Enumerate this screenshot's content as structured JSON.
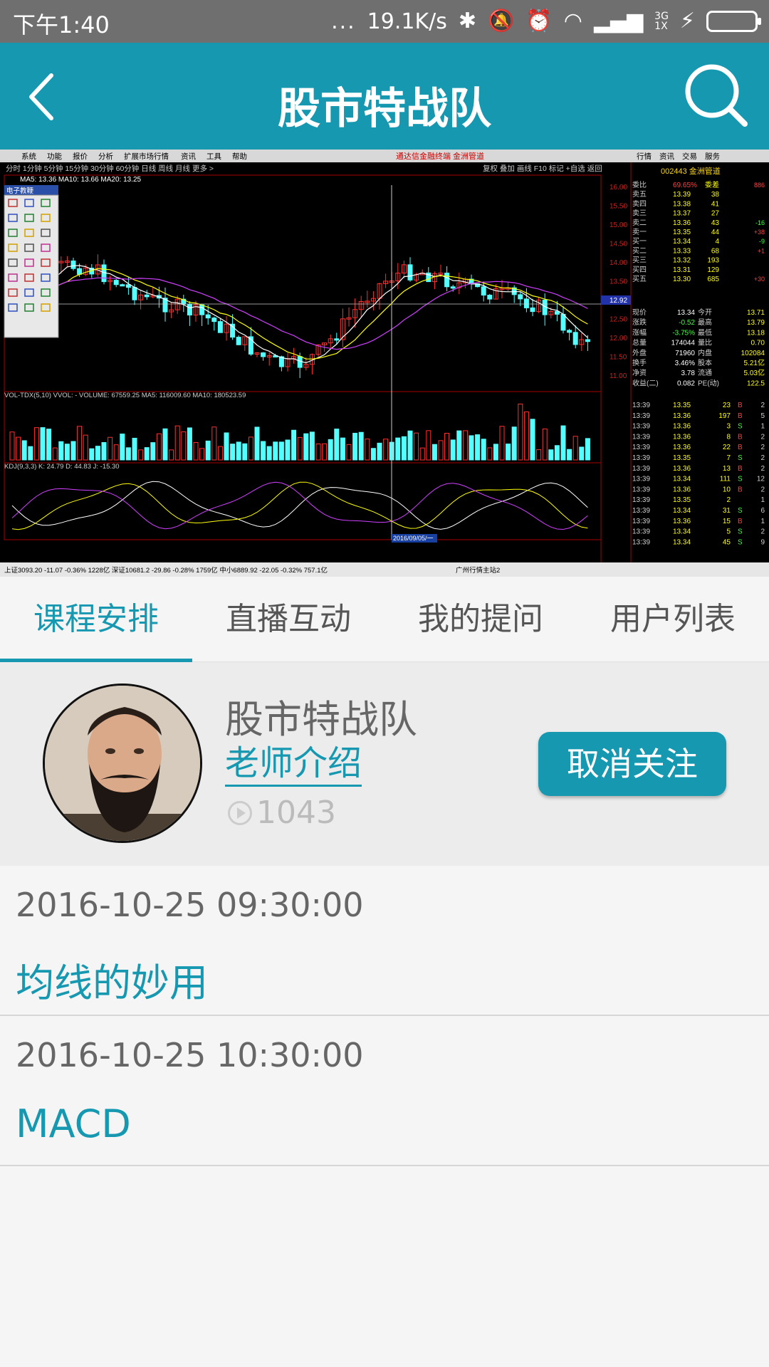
{
  "status_bar": {
    "time": "下午1:40",
    "dots": "...",
    "speed": "19.1K/s",
    "net_top": "3G",
    "net_bottom": "1X"
  },
  "header": {
    "title": "股市特战队",
    "back_icon": "chevron-left-icon",
    "search_icon": "search-icon"
  },
  "video": {
    "menu_items": [
      "系统",
      "功能",
      "报价",
      "分析",
      "扩展市场行情",
      "资讯",
      "工具",
      "帮助"
    ],
    "menu_red": "通达信金融终端   金洲管道",
    "menu_right": [
      "行情",
      "资讯",
      "交易",
      "服务"
    ],
    "periods": "分时  1分钟  5分钟  15分钟  30分钟  60分钟  日线  周线  月线  更多 >",
    "top_right_tools": "复权  叠加  画线  F10  标记  +自选  返回",
    "ma_line": "MA5: 13.36  MA10: 13.66  MA20: 13.25",
    "draw_toolbox": "电子教鞭",
    "stock_title": "002443 金洲管道",
    "vol_label": "VOL-TDX(5,10)  VVOL: -  VOLUME: 67559.25  MA5: 116009.60  MA10: 180523.59",
    "kdj_label": "KDJ(9,3,3)  K: 24.79  D: 44.83  J: -15.30",
    "date_label": "2016/09/05/一",
    "index_bar": "上证3093.20  -11.07  -0.36%  1228亿   深证10681.2  -29.86  -0.28%  1759亿   中小6889.92  -22.05  -0.32%  757.1亿",
    "server": "广州行情主站2",
    "price_ticks": [
      "16.00",
      "15.50",
      "15.00",
      "14.50",
      "14.00",
      "13.50",
      "12.92",
      "12.50",
      "12.00",
      "11.50",
      "11.00"
    ],
    "order_book": [
      [
        "委比",
        "69.65%",
        "委差",
        "886"
      ],
      [
        "卖五",
        "13.39",
        "38",
        ""
      ],
      [
        "卖四",
        "13.38",
        "41",
        ""
      ],
      [
        "卖三",
        "13.37",
        "27",
        ""
      ],
      [
        "卖二",
        "13.36",
        "43",
        "-16"
      ],
      [
        "卖一",
        "13.35",
        "44",
        "+38"
      ],
      [
        "买一",
        "13.34",
        "4",
        "-9"
      ],
      [
        "买二",
        "13.33",
        "68",
        "+1"
      ],
      [
        "买三",
        "13.32",
        "193",
        ""
      ],
      [
        "买四",
        "13.31",
        "129",
        ""
      ],
      [
        "买五",
        "13.30",
        "685",
        "+30"
      ]
    ],
    "quote_stats": [
      [
        "现价",
        "13.34",
        "今开",
        "13.71"
      ],
      [
        "涨跌",
        "-0.52",
        "最高",
        "13.79"
      ],
      [
        "涨幅",
        "-3.75%",
        "最低",
        "13.18"
      ],
      [
        "总量",
        "174044",
        "量比",
        "0.70"
      ],
      [
        "外盘",
        "71960",
        "内盘",
        "102084"
      ],
      [
        "换手",
        "3.46%",
        "股本",
        "5.21亿"
      ],
      [
        "净资",
        "3.78",
        "流通",
        "5.03亿"
      ],
      [
        "收益(二)",
        "0.082",
        "PE(动)",
        "122.5"
      ]
    ],
    "ticks": [
      [
        "13:39",
        "13.35",
        "23",
        "B",
        "2"
      ],
      [
        "13:39",
        "13.36",
        "197",
        "B",
        "5"
      ],
      [
        "13:39",
        "13.36",
        "3",
        "S",
        "1"
      ],
      [
        "13:39",
        "13.36",
        "8",
        "B",
        "2"
      ],
      [
        "13:39",
        "13.36",
        "22",
        "B",
        "2"
      ],
      [
        "13:39",
        "13.35",
        "7",
        "S",
        "2"
      ],
      [
        "13:39",
        "13.36",
        "13",
        "B",
        "2"
      ],
      [
        "13:39",
        "13.34",
        "111",
        "S",
        "12"
      ],
      [
        "13:39",
        "13.36",
        "10",
        "B",
        "2"
      ],
      [
        "13:39",
        "13.35",
        "2",
        "",
        "1"
      ],
      [
        "13:39",
        "13.34",
        "31",
        "S",
        "6"
      ],
      [
        "13:39",
        "13.36",
        "15",
        "B",
        "1"
      ],
      [
        "13:39",
        "13.34",
        "5",
        "S",
        "2"
      ],
      [
        "13:39",
        "13.34",
        "45",
        "S",
        "9"
      ]
    ]
  },
  "tabs": [
    {
      "label": "课程安排",
      "active": true
    },
    {
      "label": "直播互动",
      "active": false
    },
    {
      "label": "我的提问",
      "active": false
    },
    {
      "label": "用户列表",
      "active": false
    }
  ],
  "teacher": {
    "name": "股市特战队",
    "intro_link": "老师介绍",
    "views": "1043",
    "unfollow_label": "取消关注"
  },
  "courses": [
    {
      "time": "2016-10-25 09:30:00",
      "title": "均线的妙用"
    },
    {
      "time": "2016-10-25 10:30:00",
      "title": "MACD"
    }
  ],
  "colors": {
    "accent": "#1798b1",
    "status_bar": "#6f6f6f",
    "battery": "#59d130"
  }
}
